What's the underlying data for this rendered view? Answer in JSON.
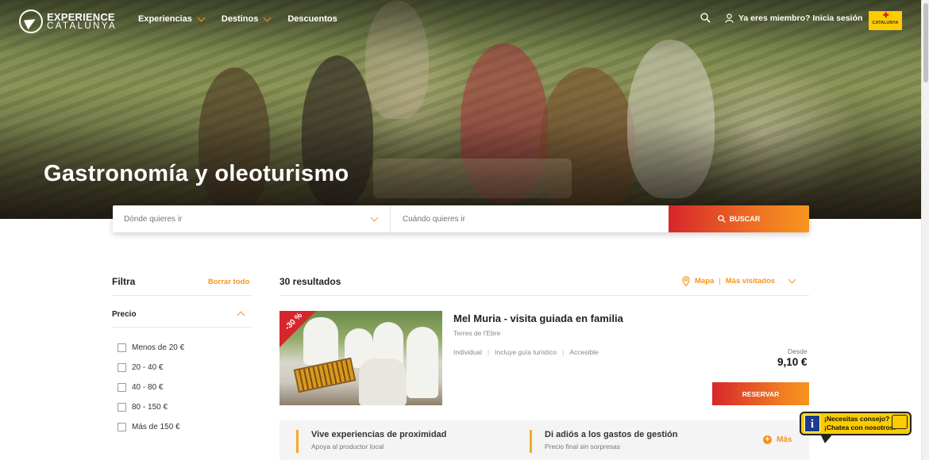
{
  "brand": {
    "line1": "EXPERIENCE",
    "line2": "CATALUNYA"
  },
  "nav": {
    "items": [
      {
        "label": "Experiencias",
        "dropdown": true
      },
      {
        "label": "Destinos",
        "dropdown": true
      },
      {
        "label": "Descuentos",
        "dropdown": false
      }
    ],
    "login_label": "Ya eres miembro? Inicia sesión",
    "badge_label": "CATALUNYA"
  },
  "hero": {
    "title": "Gastronomía y oleoturismo"
  },
  "search": {
    "where_placeholder": "Dónde quieres ir",
    "when_placeholder": "Cuándo quieres ir",
    "button_label": "BUSCAR"
  },
  "filter": {
    "title": "Filtra",
    "clear_label": "Borrar todo",
    "price_title": "Precio",
    "options": [
      "Menos de 20 €",
      "20 - 40 €",
      "40 - 80 €",
      "80 - 150 €",
      "Más de 150 €"
    ]
  },
  "results": {
    "count_label": "30 resultados",
    "map_label": "Mapa",
    "sort_label": "Más visitados"
  },
  "card": {
    "discount": "-30 %",
    "title": "Mel Muria - visita guiada en familia",
    "location": "Terres de l'Ebre",
    "tags": [
      "Individual",
      "Incluye guía turístico",
      "Accesible"
    ],
    "from_label": "Desde",
    "price": "9,10 €",
    "reserve_label": "RESERVAR"
  },
  "benefits": {
    "items": [
      {
        "title": "Vive experiencias de proximidad",
        "subtitle": "Apoya al productor local"
      },
      {
        "title": "Di adiós a los gastos de gestión",
        "subtitle": "Precio final sin sorpresas"
      }
    ],
    "more_label": "Más"
  },
  "chat": {
    "line1": "¡Necesitas consejo?",
    "line2": "¡Chatea con nosotros!"
  },
  "colors": {
    "accent": "#f7941d",
    "brand_red": "#d7262b",
    "badge_yellow": "#fccc00"
  }
}
